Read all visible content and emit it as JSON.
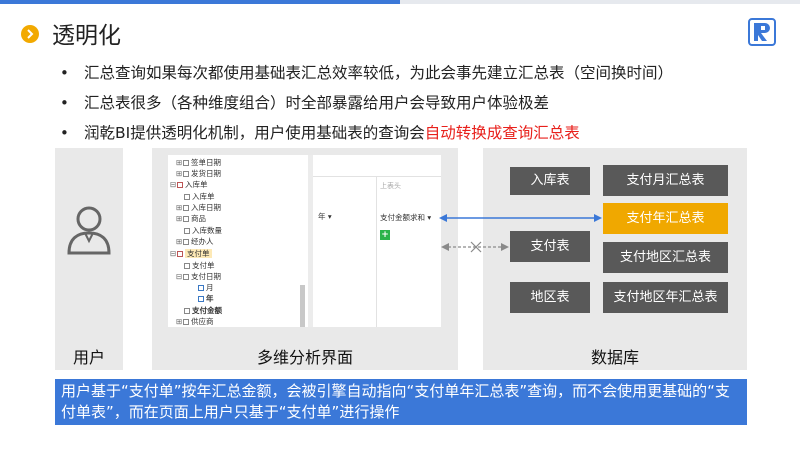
{
  "header": {
    "title": "透明化",
    "accent_color": "#3b78d8",
    "title_icon": "chevron-right-circle-icon",
    "logo_icon": "brand-logo-icon"
  },
  "bullets": [
    {
      "text": "汇总查询如果每次都使用基础表汇总效率较低，为此会事先建立汇总表（空间换时间）"
    },
    {
      "text": "汇总表很多（各种维度组合）时全部暴露给用户会导致用户体验极差"
    },
    {
      "text_prefix": "润乾BI提供透明化机制，用户使用基础表的查询会",
      "text_highlight": "自动转换成查询汇总表",
      "highlight_color": "#e8211c"
    }
  ],
  "panels": {
    "user_label": "用户",
    "ui_label": "多维分析界面",
    "db_label": "数据库"
  },
  "tree": [
    "签单日期",
    "发货日期",
    "入库单",
    "入库单",
    "入库日期",
    "商品",
    "入库数量",
    "经办人",
    "支付单",
    "支付单",
    "支付日期",
    "月",
    "年",
    "支付金额",
    "供应商"
  ],
  "pivot": {
    "col_header": "上表头",
    "row_dim": "年 ▾",
    "measure": "支付金额求和 ▾",
    "add": "+"
  },
  "db": {
    "tables": [
      "入库表",
      "支付表",
      "地区表"
    ],
    "summaries": [
      "支付月汇总表",
      "支付年汇总表",
      "支付地区汇总表",
      "支付地区年汇总表"
    ],
    "highlight_color": "#f0a800"
  },
  "caption": "用户基于“支付单”按年汇总金额，会被引擎自动指向“支付单年汇总表”查询，而不会使用更基础的“支付单表”，而在页面上用户只基于“支付单”进行操作"
}
